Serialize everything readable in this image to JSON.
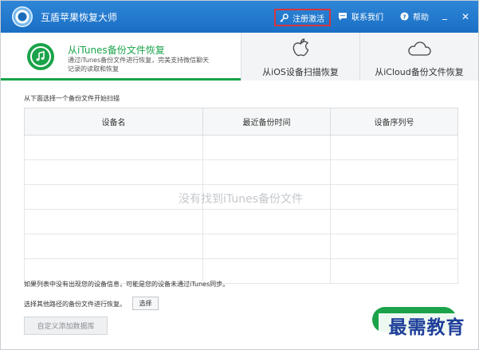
{
  "app": {
    "title": "互盾苹果恢复大师"
  },
  "titlebar": {
    "register_label": "注册激活",
    "contact_label": "联系我们",
    "help_label": "帮助",
    "minimize_glyph": "_",
    "close_glyph": "✕"
  },
  "tabs": [
    {
      "label": "从iTunes备份文件恢复",
      "description": "通过iTunes备份文件进行恢复，完美支持微信聊天记录的读取和恢复",
      "icon": "itunes-music-icon",
      "active": true
    },
    {
      "label": "从iOS设备扫描恢复",
      "icon": "apple-icon",
      "active": false
    },
    {
      "label": "从iCloud备份文件恢复",
      "icon": "cloud-icon",
      "active": false
    }
  ],
  "content": {
    "scan_hint": "从下面选择一个备份文件开始扫描",
    "table": {
      "columns": [
        "设备名",
        "最近备份时间",
        "设备序列号"
      ],
      "rows": []
    },
    "empty_message": "没有找到iTunes备份文件",
    "note": "如果列表中没有出现您的设备信息，可能是您的设备未通过iTunes同步。",
    "choose_text": "选择其他路径的备份文件进行恢复。",
    "choose_button": "选择",
    "custom_db_button": "自定义添加数据库"
  },
  "watermark": "最需教育",
  "colors": {
    "titlebar": "#1f78cc",
    "accent_green": "#1aa34a",
    "highlight_red": "#d8343a"
  }
}
